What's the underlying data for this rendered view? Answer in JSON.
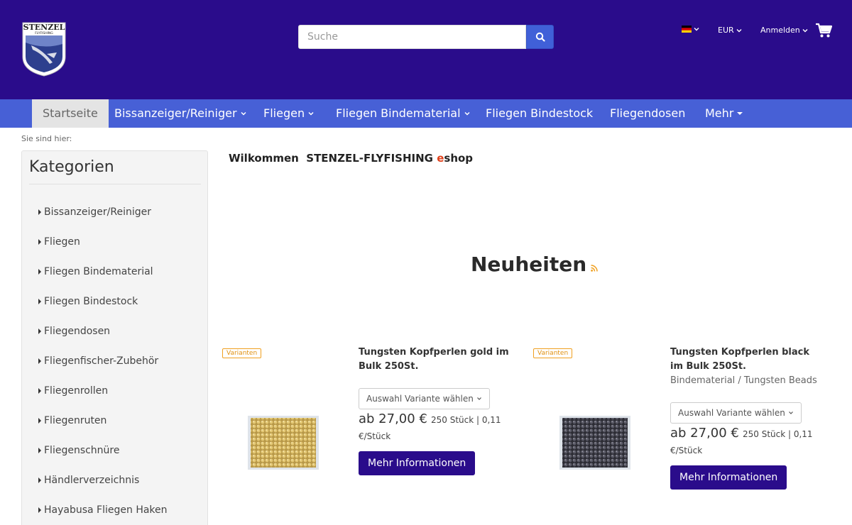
{
  "brand": {
    "logo_text": "STENZEL",
    "logo_sub": "FLYFISHING"
  },
  "search": {
    "placeholder": "Suche"
  },
  "header": {
    "currency": "EUR",
    "login": "Anmelden"
  },
  "nav": {
    "items": [
      "Startseite",
      "Bissanzeiger/Reiniger",
      "Fliegen",
      "Fliegen Bindematerial",
      "Fliegen Bindestock",
      "Fliegendosen",
      "Mehr"
    ]
  },
  "breadcrumb": "Sie sind hier:",
  "sidebar": {
    "title": "Kategorien",
    "items": [
      "Bissanzeiger/Reiniger",
      "Fliegen",
      "Fliegen Bindematerial",
      "Fliegen Bindestock",
      "Fliegendosen",
      "Fliegenfischer-Zubehör",
      "Fliegenrollen",
      "Fliegenruten",
      "Fliegenschnüre",
      "Händlerverzeichnis",
      "Hayabusa Fliegen Haken"
    ]
  },
  "welcome": {
    "prefix": "Wilkommen  STENZEL-FLYFISHING ",
    "e": "e",
    "suffix": "shop"
  },
  "news": {
    "title": "Neuheiten"
  },
  "products": [
    {
      "badge": "Varianten",
      "title": "Tungsten Kopfperlen gold im Bulk 250St.",
      "category": "",
      "variant": "Auswahl Variante wählen",
      "price": "ab 27,00 €",
      "unit": "250 Stück | 0,11 €/Stück",
      "button": "Mehr Informationen"
    },
    {
      "badge": "Varianten",
      "title": "Tungsten Kopfperlen black im Bulk 250St.",
      "category": "Bindematerial / Tungsten Beads",
      "variant": "Auswahl Variante wählen",
      "price": "ab 27,00 €",
      "unit": "250 Stück | 0,11 €/Stück",
      "button": "Mehr Informationen"
    }
  ],
  "colors": {
    "header_bg": "#2a0c8b",
    "nav_bg": "#4760d6",
    "accent": "#e0401a",
    "badge": "#f0a020"
  }
}
